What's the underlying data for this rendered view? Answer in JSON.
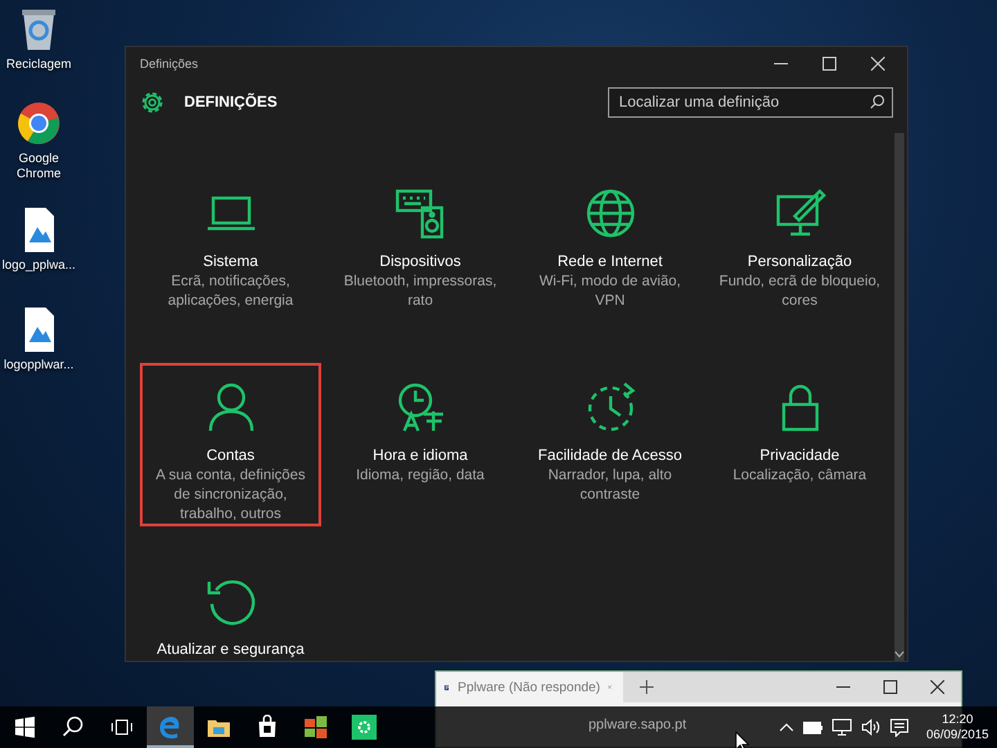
{
  "desktop_icons": [
    {
      "label": "Reciclagem"
    },
    {
      "label": "Google Chrome"
    },
    {
      "label": "logo_pplwa..."
    },
    {
      "label": "logopplwar..."
    }
  ],
  "settings_window": {
    "title": "Definições",
    "heading": "DEFINIÇÕES",
    "search": {
      "placeholder": "Localizar uma definição"
    },
    "categories": [
      {
        "title": "Sistema",
        "description": "Ecrã, notificações, aplicações, energia",
        "selected": false
      },
      {
        "title": "Dispositivos",
        "description": "Bluetooth, impressoras, rato",
        "selected": false
      },
      {
        "title": "Rede e Internet",
        "description": "Wi-Fi, modo de avião, VPN",
        "selected": false
      },
      {
        "title": "Personalização",
        "description": "Fundo, ecrã de bloqueio, cores",
        "selected": false
      },
      {
        "title": "Contas",
        "description": "A sua conta, definições de sincronização, trabalho, outros",
        "selected": true
      },
      {
        "title": "Hora e idioma",
        "description": "Idioma, região, data",
        "selected": false
      },
      {
        "title": "Facilidade de Acesso",
        "description": "Narrador, lupa, alto contraste",
        "selected": false
      },
      {
        "title": "Privacidade",
        "description": "Localização, câmara",
        "selected": false
      },
      {
        "title": "Atualizar e segurança",
        "selected": false
      }
    ]
  },
  "browser_window": {
    "tab_title": "Pplware (Não responde)",
    "address": "pplware.sapo.pt"
  },
  "taskbar": {
    "apps": [
      {
        "selected": false
      },
      {
        "selected": false
      },
      {
        "selected": false
      },
      {
        "selected": true
      },
      {
        "selected": false
      },
      {
        "selected": false
      },
      {
        "selected": false
      },
      {
        "selected": false
      }
    ],
    "time": "12:20",
    "date": "06/09/2015"
  }
}
